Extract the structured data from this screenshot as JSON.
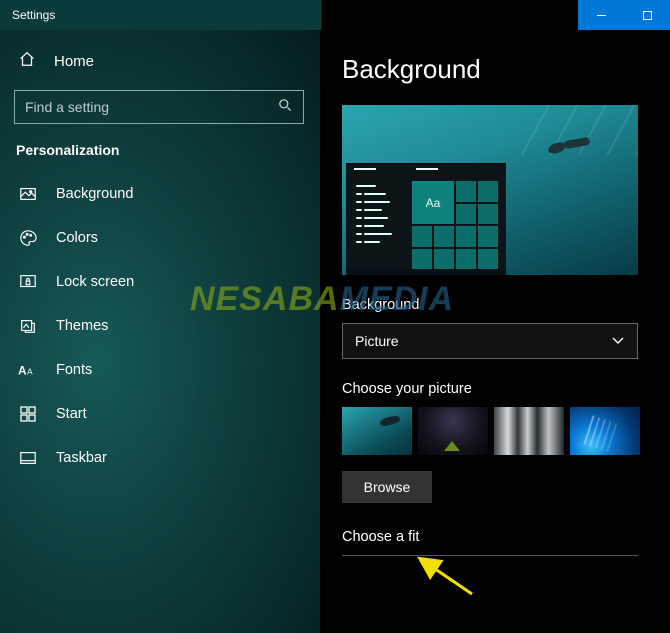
{
  "window": {
    "title": "Settings"
  },
  "sidebar": {
    "home": "Home",
    "search_placeholder": "Find a setting",
    "category": "Personalization",
    "items": [
      {
        "label": "Background"
      },
      {
        "label": "Colors"
      },
      {
        "label": "Lock screen"
      },
      {
        "label": "Themes"
      },
      {
        "label": "Fonts"
      },
      {
        "label": "Start"
      },
      {
        "label": "Taskbar"
      }
    ]
  },
  "main": {
    "title": "Background",
    "preview_tile_text": "Aa",
    "bg_label": "Background",
    "bg_select_value": "Picture",
    "choose_picture_label": "Choose your picture",
    "browse_label": "Browse",
    "choose_fit_label": "Choose a fit"
  },
  "watermark": {
    "part1": "NESABA",
    "part2": "MEDIA"
  }
}
